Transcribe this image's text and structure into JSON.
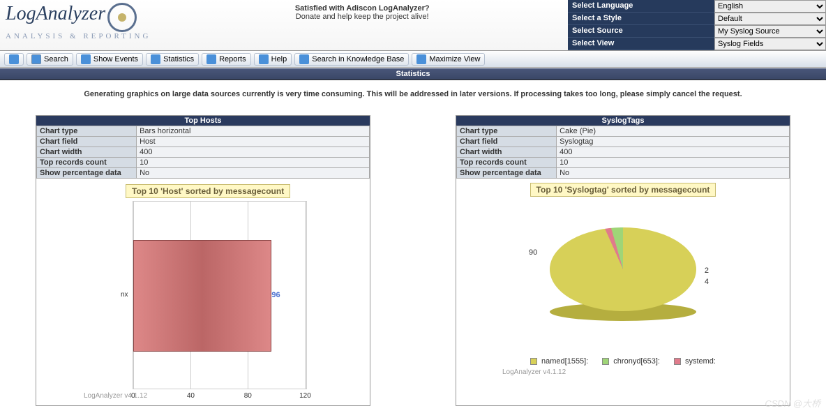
{
  "header": {
    "logo_name": "LogAnalyzer",
    "logo_tag": "ANALYSIS & REPORTING",
    "center_bold": "Satisfied with Adiscon LogAnalyzer?",
    "center_sub": "Donate and help keep the project alive!"
  },
  "controls": [
    {
      "label": "Select Language",
      "value": "English"
    },
    {
      "label": "Select a Style",
      "value": "Default"
    },
    {
      "label": "Select Source",
      "value": "My Syslog Source"
    },
    {
      "label": "Select View",
      "value": "Syslog Fields"
    }
  ],
  "menu": {
    "search": "Search",
    "show_events": "Show Events",
    "statistics": "Statistics",
    "reports": "Reports",
    "help": "Help",
    "kb": "Search in Knowledge Base",
    "max": "Maximize View"
  },
  "page_title": "Statistics",
  "notice": "Generating graphics on large data sources currently is very time consuming. This will be addressed in later versions. If processing takes too long, please simply cancel the request.",
  "panels": {
    "hosts": {
      "title": "Top Hosts",
      "rows": [
        [
          "Chart type",
          "Bars horizontal"
        ],
        [
          "Chart field",
          "Host"
        ],
        [
          "Chart width",
          "400"
        ],
        [
          "Top records count",
          "10"
        ],
        [
          "Show percentage data",
          "No"
        ]
      ],
      "chart_title": "Top 10 'Host' sorted by messagecount",
      "credit": "LogAnalyzer v4.1.12"
    },
    "tags": {
      "title": "SyslogTags",
      "rows": [
        [
          "Chart type",
          "Cake (Pie)"
        ],
        [
          "Chart field",
          "Syslogtag"
        ],
        [
          "Chart width",
          "400"
        ],
        [
          "Top records count",
          "10"
        ],
        [
          "Show percentage data",
          "No"
        ]
      ],
      "chart_title": "Top 10 'Syslogtag' sorted by messagecount",
      "credit": "LogAnalyzer v4.1.12"
    }
  },
  "chart_data": [
    {
      "type": "bar",
      "orientation": "horizontal",
      "title": "Top 10 'Host' sorted by messagecount",
      "categories": [
        "nx"
      ],
      "values": [
        96
      ],
      "xlim": [
        0,
        120
      ],
      "xticks": [
        0,
        40,
        80,
        120
      ],
      "xlabel": "",
      "ylabel": ""
    },
    {
      "type": "pie",
      "title": "Top 10 'Syslogtag' sorted by messagecount",
      "series": [
        {
          "name": "named[1555]:",
          "value": 90,
          "color": "#d7d058"
        },
        {
          "name": "chronyd[653]:",
          "value": 4,
          "color": "#9fd577"
        },
        {
          "name": "systemd:",
          "value": 2,
          "color": "#e07b8b"
        }
      ]
    }
  ],
  "watermark": "CSDN @大桥"
}
